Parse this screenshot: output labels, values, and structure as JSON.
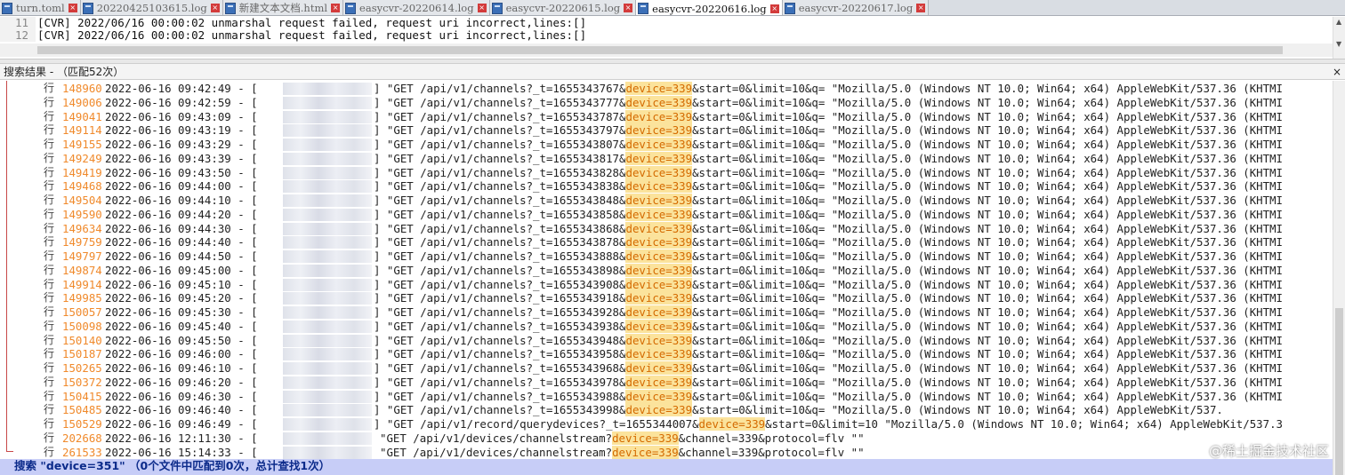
{
  "tabs": [
    {
      "label": "turn.toml",
      "active": false
    },
    {
      "label": "20220425103615.log",
      "active": false
    },
    {
      "label": "新建文本文档.html",
      "active": false
    },
    {
      "label": "easycvr-20220614.log",
      "active": false
    },
    {
      "label": "easycvr-20220615.log",
      "active": false
    },
    {
      "label": "easycvr-20220616.log",
      "active": true
    },
    {
      "label": "easycvr-20220617.log",
      "active": false
    }
  ],
  "editor": {
    "lines": [
      {
        "num": "11",
        "text": "[CVR] 2022/06/16 00:00:02 unmarshal request failed, request uri incorrect,lines:[]"
      },
      {
        "num": "12",
        "text": "[CVR] 2022/06/16 00:00:02 unmarshal request failed, request uri incorrect,lines:[]"
      }
    ]
  },
  "results": {
    "header": "搜索结果 - （匹配52次）",
    "close_icon": "×",
    "line_prefix": "行",
    "rows": [
      {
        "line": "148960",
        "time": "2022-06-16 09:42:49 - [",
        "pre": "\"GET /api/v1/channels?_t=1655343767&",
        "match": "device=339",
        "post": "&start=0&limit=10&q= \"Mozilla/5.0 (Windows NT 10.0; Win64; x64) AppleWebKit/537.36 (KHTMI"
      },
      {
        "line": "149006",
        "time": "2022-06-16 09:42:59 - [",
        "pre": "\"GET /api/v1/channels?_t=1655343777&",
        "match": "device=339",
        "post": "&start=0&limit=10&q= \"Mozilla/5.0 (Windows NT 10.0; Win64; x64) AppleWebKit/537.36 (KHTMI"
      },
      {
        "line": "149041",
        "time": "2022-06-16 09:43:09 - [",
        "pre": "\"GET /api/v1/channels?_t=1655343787&",
        "match": "device=339",
        "post": "&start=0&limit=10&q= \"Mozilla/5.0 (Windows NT 10.0; Win64; x64) AppleWebKit/537.36 (KHTMI"
      },
      {
        "line": "149114",
        "time": "2022-06-16 09:43:19 - [",
        "pre": "\"GET /api/v1/channels?_t=1655343797&",
        "match": "device=339",
        "post": "&start=0&limit=10&q= \"Mozilla/5.0 (Windows NT 10.0; Win64; x64) AppleWebKit/537.36 (KHTMI"
      },
      {
        "line": "149155",
        "time": "2022-06-16 09:43:29 - [",
        "pre": "\"GET /api/v1/channels?_t=1655343807&",
        "match": "device=339",
        "post": "&start=0&limit=10&q= \"Mozilla/5.0 (Windows NT 10.0; Win64; x64) AppleWebKit/537.36 (KHTMI"
      },
      {
        "line": "149249",
        "time": "2022-06-16 09:43:39 - [",
        "pre": "\"GET /api/v1/channels?_t=1655343817&",
        "match": "device=339",
        "post": "&start=0&limit=10&q= \"Mozilla/5.0 (Windows NT 10.0; Win64; x64) AppleWebKit/537.36 (KHTMI"
      },
      {
        "line": "149419",
        "time": "2022-06-16 09:43:50 - [",
        "pre": "\"GET /api/v1/channels?_t=1655343828&",
        "match": "device=339",
        "post": "&start=0&limit=10&q= \"Mozilla/5.0 (Windows NT 10.0; Win64; x64) AppleWebKit/537.36 (KHTMI"
      },
      {
        "line": "149468",
        "time": "2022-06-16 09:44:00 - [",
        "pre": "\"GET /api/v1/channels?_t=1655343838&",
        "match": "device=339",
        "post": "&start=0&limit=10&q= \"Mozilla/5.0 (Windows NT 10.0; Win64; x64) AppleWebKit/537.36 (KHTMI"
      },
      {
        "line": "149504",
        "time": "2022-06-16 09:44:10 - [",
        "pre": "\"GET /api/v1/channels?_t=1655343848&",
        "match": "device=339",
        "post": "&start=0&limit=10&q= \"Mozilla/5.0 (Windows NT 10.0; Win64; x64) AppleWebKit/537.36 (KHTMI"
      },
      {
        "line": "149590",
        "time": "2022-06-16 09:44:20 - [",
        "pre": "\"GET /api/v1/channels?_t=1655343858&",
        "match": "device=339",
        "post": "&start=0&limit=10&q= \"Mozilla/5.0 (Windows NT 10.0; Win64; x64) AppleWebKit/537.36 (KHTMI"
      },
      {
        "line": "149634",
        "time": "2022-06-16 09:44:30 - [",
        "pre": "\"GET /api/v1/channels?_t=1655343868&",
        "match": "device=339",
        "post": "&start=0&limit=10&q= \"Mozilla/5.0 (Windows NT 10.0; Win64; x64) AppleWebKit/537.36 (KHTMI"
      },
      {
        "line": "149759",
        "time": "2022-06-16 09:44:40 - [",
        "pre": "\"GET /api/v1/channels?_t=1655343878&",
        "match": "device=339",
        "post": "&start=0&limit=10&q= \"Mozilla/5.0 (Windows NT 10.0; Win64; x64) AppleWebKit/537.36 (KHTMI"
      },
      {
        "line": "149797",
        "time": "2022-06-16 09:44:50 - [",
        "pre": "\"GET /api/v1/channels?_t=1655343888&",
        "match": "device=339",
        "post": "&start=0&limit=10&q= \"Mozilla/5.0 (Windows NT 10.0; Win64; x64) AppleWebKit/537.36 (KHTMI"
      },
      {
        "line": "149874",
        "time": "2022-06-16 09:45:00 - [",
        "pre": "\"GET /api/v1/channels?_t=1655343898&",
        "match": "device=339",
        "post": "&start=0&limit=10&q= \"Mozilla/5.0 (Windows NT 10.0; Win64; x64) AppleWebKit/537.36 (KHTMI"
      },
      {
        "line": "149914",
        "time": "2022-06-16 09:45:10 - [",
        "pre": "\"GET /api/v1/channels?_t=1655343908&",
        "match": "device=339",
        "post": "&start=0&limit=10&q= \"Mozilla/5.0 (Windows NT 10.0; Win64; x64) AppleWebKit/537.36 (KHTMI"
      },
      {
        "line": "149985",
        "time": "2022-06-16 09:45:20 - [",
        "pre": "\"GET /api/v1/channels?_t=1655343918&",
        "match": "device=339",
        "post": "&start=0&limit=10&q= \"Mozilla/5.0 (Windows NT 10.0; Win64; x64) AppleWebKit/537.36 (KHTMI"
      },
      {
        "line": "150057",
        "time": "2022-06-16 09:45:30 - [",
        "pre": "\"GET /api/v1/channels?_t=1655343928&",
        "match": "device=339",
        "post": "&start=0&limit=10&q= \"Mozilla/5.0 (Windows NT 10.0; Win64; x64) AppleWebKit/537.36 (KHTMI"
      },
      {
        "line": "150098",
        "time": "2022-06-16 09:45:40 - [",
        "pre": "\"GET /api/v1/channels?_t=1655343938&",
        "match": "device=339",
        "post": "&start=0&limit=10&q= \"Mozilla/5.0 (Windows NT 10.0; Win64; x64) AppleWebKit/537.36 (KHTMI"
      },
      {
        "line": "150140",
        "time": "2022-06-16 09:45:50 - [",
        "pre": "\"GET /api/v1/channels?_t=1655343948&",
        "match": "device=339",
        "post": "&start=0&limit=10&q= \"Mozilla/5.0 (Windows NT 10.0; Win64; x64) AppleWebKit/537.36 (KHTMI"
      },
      {
        "line": "150187",
        "time": "2022-06-16 09:46:00 - [",
        "pre": "\"GET /api/v1/channels?_t=1655343958&",
        "match": "device=339",
        "post": "&start=0&limit=10&q= \"Mozilla/5.0 (Windows NT 10.0; Win64; x64) AppleWebKit/537.36 (KHTMI"
      },
      {
        "line": "150265",
        "time": "2022-06-16 09:46:10 - [",
        "pre": "\"GET /api/v1/channels?_t=1655343968&",
        "match": "device=339",
        "post": "&start=0&limit=10&q= \"Mozilla/5.0 (Windows NT 10.0; Win64; x64) AppleWebKit/537.36 (KHTMI"
      },
      {
        "line": "150372",
        "time": "2022-06-16 09:46:20 - [",
        "pre": "\"GET /api/v1/channels?_t=1655343978&",
        "match": "device=339",
        "post": "&start=0&limit=10&q= \"Mozilla/5.0 (Windows NT 10.0; Win64; x64) AppleWebKit/537.36 (KHTMI"
      },
      {
        "line": "150415",
        "time": "2022-06-16 09:46:30 - [",
        "pre": "\"GET /api/v1/channels?_t=1655343988&",
        "match": "device=339",
        "post": "&start=0&limit=10&q= \"Mozilla/5.0 (Windows NT 10.0; Win64; x64) AppleWebKit/537.36 (KHTMI"
      },
      {
        "line": "150485",
        "time": "2022-06-16 09:46:40 - [",
        "pre": "\"GET /api/v1/channels?_t=1655343998&",
        "match": "device=339",
        "post": "&start=0&limit=10&q= \"Mozilla/5.0 (Windows NT 10.0; Win64; x64) AppleWebKit/537."
      },
      {
        "line": "150529",
        "time": "2022-06-16 09:46:49 - [",
        "pre": "\"GET /api/v1/record/querydevices?_t=1655344007&",
        "match": "device=339",
        "post": "&start=0&limit=10 \"Mozilla/5.0 (Windows NT 10.0; Win64; x64) AppleWebKit/537.3"
      },
      {
        "line": "202668",
        "time": "2022-06-16 12:11:30 - [",
        "pre": "\"GET /api/v1/devices/channelstream?",
        "match": "device=339",
        "post": "&channel=339&protocol=flv \"\""
      },
      {
        "line": "261533",
        "time": "2022-06-16 15:14:33 - [",
        "pre": "\"GET /api/v1/devices/channelstream?",
        "match": "device=339",
        "post": "&channel=339&protocol=flv \"\""
      }
    ],
    "footer": "搜索 \"device=351\" （0个文件中匹配到0次，总计查找1次）"
  },
  "watermark": "@稀土掘金技术社区",
  "colors": {
    "line_number": "#f08a2c",
    "match_bg": "#fbe39c",
    "match_fg": "#d46a00",
    "footer_bg": "#c7cdf7",
    "active_tab": "#ffffff"
  }
}
